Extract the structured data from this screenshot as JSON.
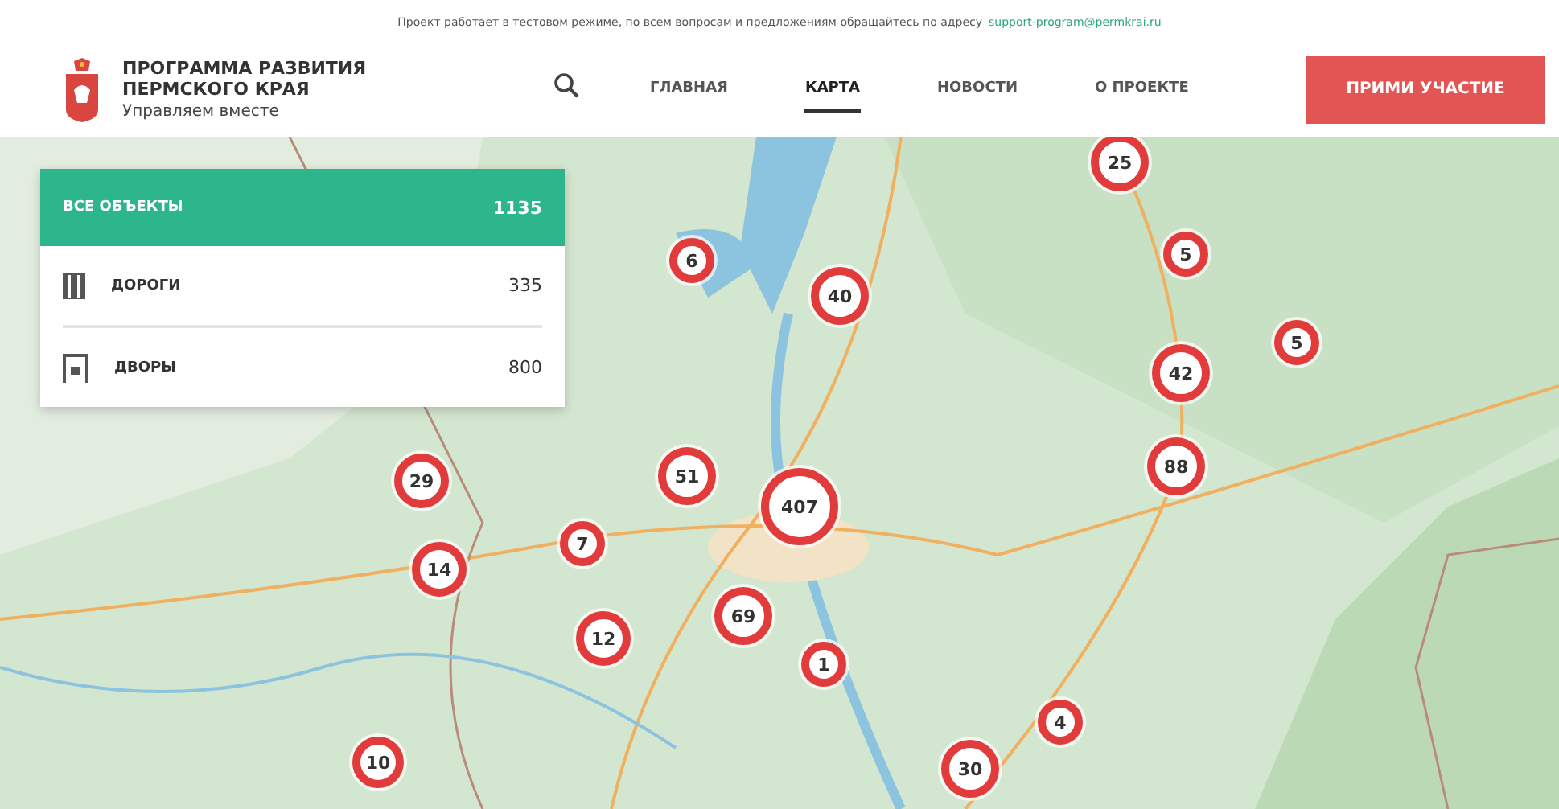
{
  "notice": {
    "text": "Проект работает в тестовом режиме, по всем вопросам и предложениям обращайтесь по адресу",
    "email": "support-program@permkrai.ru"
  },
  "brand": {
    "title_lines": [
      "ПРОГРАММА РАЗВИТИЯ",
      "ПЕРМСКОГО КРАЯ"
    ],
    "subtitle": "Управляем вместе"
  },
  "nav": [
    {
      "label": "ГЛАВНАЯ",
      "selected": false
    },
    {
      "label": "КАРТА",
      "selected": true
    },
    {
      "label": "НОВОСТИ",
      "selected": false
    },
    {
      "label": "О ПРОЕКТЕ",
      "selected": false
    }
  ],
  "cta": "ПРИМИ УЧАСТИЕ",
  "filters": [
    {
      "kind": "all",
      "label": "ВСЕ ОБЪЕКТЫ",
      "count": "1135",
      "selected": true
    },
    {
      "kind": "roads",
      "label": "ДОРОГИ",
      "count": "335",
      "selected": false
    },
    {
      "kind": "yards",
      "label": "ДВОРЫ",
      "count": "800",
      "selected": false
    }
  ],
  "map": {
    "clusters": [
      "25",
      "6",
      "40",
      "5",
      "5",
      "42",
      "88",
      "29",
      "51",
      "407",
      "7",
      "14",
      "12",
      "69",
      "1",
      "4",
      "30",
      "10"
    ]
  }
}
